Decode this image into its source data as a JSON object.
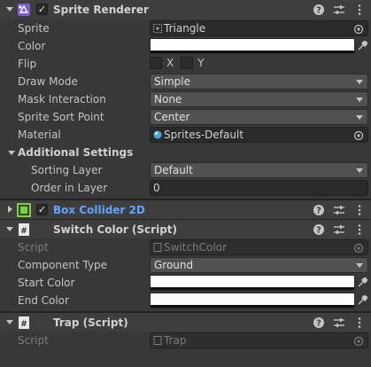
{
  "sprite_renderer": {
    "title": "Sprite Renderer",
    "fields": {
      "sprite_label": "Sprite",
      "sprite_value": "Triangle",
      "color_label": "Color",
      "color_value": "#ffffff",
      "flip_label": "Flip",
      "flip_x": "X",
      "flip_y": "Y",
      "draw_mode_label": "Draw Mode",
      "draw_mode_value": "Simple",
      "mask_label": "Mask Interaction",
      "mask_value": "None",
      "sort_point_label": "Sprite Sort Point",
      "sort_point_value": "Center",
      "material_label": "Material",
      "material_value": "Sprites-Default"
    },
    "additional": {
      "title": "Additional Settings",
      "sorting_layer_label": "Sorting Layer",
      "sorting_layer_value": "Default",
      "order_label": "Order in Layer",
      "order_value": "0"
    }
  },
  "box_collider": {
    "title": "Box Collider 2D",
    "collapsed": true
  },
  "switch_color": {
    "title": "Switch Color (Script)",
    "script_label": "Script",
    "script_value": "SwitchColor",
    "type_label": "Component Type",
    "type_value": "Ground",
    "start_label": "Start Color",
    "start_value": "#ffffff",
    "end_label": "End Color",
    "end_value": "#ffffff"
  },
  "trap": {
    "title": "Trap (Script)",
    "script_label": "Script",
    "script_value": "Trap"
  },
  "icons": {
    "help": "help-icon",
    "presets": "presets-icon",
    "more": "more-vert-icon"
  }
}
